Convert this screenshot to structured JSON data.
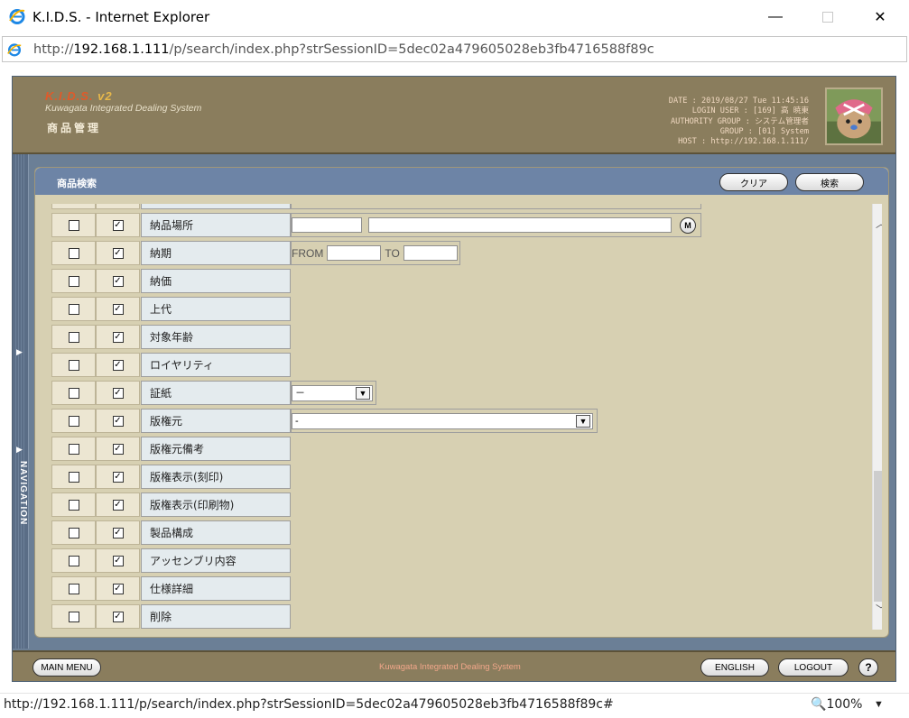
{
  "window": {
    "title": "K.I.D.S. - Internet Explorer"
  },
  "address": {
    "prefix": "http://",
    "host": "192.168.1.111",
    "path": "/p/search/index.php?strSessionID=5dec02a479605028eb3fb4716588f89c"
  },
  "header": {
    "logo_main": "K.I.D.S.",
    "logo_ver": "v2",
    "logo_sub": "Kuwagata Integrated Dealing System",
    "section": "商品管理",
    "info": [
      "DATE : 2019/08/27 Tue 11:45:16",
      "LOGIN USER : [169] 高 暁東",
      "AUTHORITY GROUP : システム管理者",
      "GROUP : [01] System",
      "HOST : http://192.168.1.111/"
    ]
  },
  "nav": {
    "label": "NAVIGATION"
  },
  "panel": {
    "title": "商品検索",
    "clear_label": "クリア",
    "search_label": "検索"
  },
  "rows": [
    {
      "label": "納品場所"
    },
    {
      "label": "納期",
      "from": "FROM",
      "to": "TO"
    },
    {
      "label": "納価"
    },
    {
      "label": "上代"
    },
    {
      "label": "対象年齢"
    },
    {
      "label": "ロイヤリティ"
    },
    {
      "label": "証紙",
      "selected": "－"
    },
    {
      "label": "版権元",
      "selected": "-"
    },
    {
      "label": "版権元備考"
    },
    {
      "label": "版権表示(刻印)"
    },
    {
      "label": "版権表示(印刷物)"
    },
    {
      "label": "製品構成"
    },
    {
      "label": "アッセンブリ内容"
    },
    {
      "label": "仕様詳細"
    },
    {
      "label": "削除"
    }
  ],
  "m_label": "M",
  "footer": {
    "main_menu": "MAIN MENU",
    "center": "Kuwagata Integrated Dealing System",
    "english": "ENGLISH",
    "logout": "LOGOUT",
    "help": "?"
  },
  "status": {
    "url": "http://192.168.1.111/p/search/index.php?strSessionID=5dec02a479605028eb3fb4716588f89c#",
    "zoom": "100%"
  }
}
